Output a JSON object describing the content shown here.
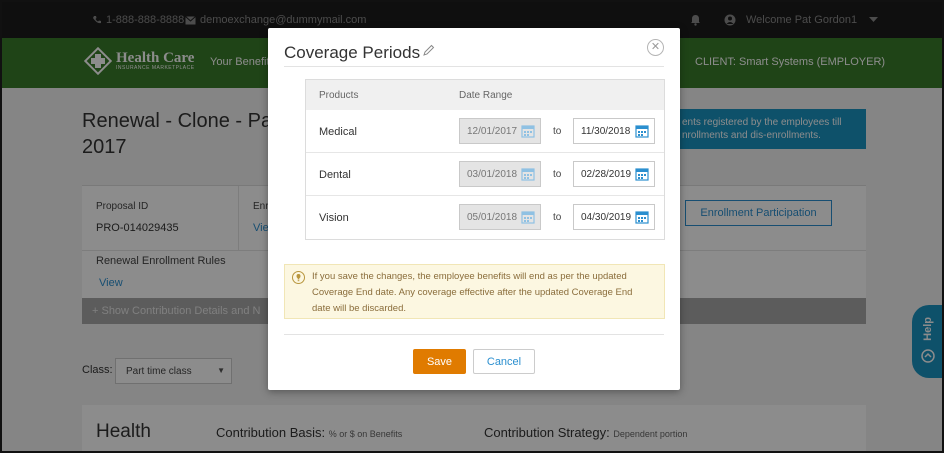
{
  "topbar": {
    "phone": "1-888-888-8888",
    "email": "demoexchange@dummymail.com",
    "welcome": "Welcome Pat Gordon1"
  },
  "nav": {
    "logo_title": "Health Care",
    "logo_subtitle": "INSURANCE MARKETPLACE",
    "your_benefits": "Your Benefits",
    "client": "CLIENT: Smart Systems (EMPLOYER)"
  },
  "page": {
    "title_line1": "Renewal - Clone - Pa",
    "title_line2": "2017",
    "banner_line1": "ents registered by the employees till",
    "banner_line2": "nrollments and dis-enrollments.",
    "proposal_id_label": "Proposal ID",
    "proposal_id_value": "PRO-014029435",
    "enr_label": "Enr",
    "view_partial": "Vie",
    "enrollment_rules_label": "Renewal Enrollment Rules",
    "view_link": "View",
    "enrollment_participation": "Enrollment Participation",
    "show_contribution": "+ Show Contribution Details and N",
    "class_label": "Class:",
    "class_value": "Part time class",
    "health": "Health",
    "contribution_basis_label": "Contribution Basis:",
    "contribution_basis_value": "% or $ on Benefits",
    "contribution_strategy_label": "Contribution Strategy:",
    "contribution_strategy_value": "Dependent portion",
    "help": "Help"
  },
  "modal": {
    "title": "Coverage Periods",
    "columns": {
      "products": "Products",
      "date_range": "Date Range"
    },
    "to_label": "to",
    "rows": [
      {
        "product": "Medical",
        "start": "12/01/2017",
        "end": "11/30/2018"
      },
      {
        "product": "Dental",
        "start": "03/01/2018",
        "end": "02/28/2019"
      },
      {
        "product": "Vision",
        "start": "05/01/2018",
        "end": "04/30/2019"
      }
    ],
    "warning_line1": "If you save the changes, the employee benefits will end as per the updated",
    "warning_line2": "Coverage End date. Any coverage effective after the updated Coverage End",
    "warning_line3": "date will be discarded.",
    "save": "Save",
    "cancel": "Cancel"
  },
  "colors": {
    "nav_green": "#3a7d2a",
    "primary_orange": "#e07b00",
    "link_blue": "#2b8fcf",
    "banner_blue": "#1a94c2"
  }
}
